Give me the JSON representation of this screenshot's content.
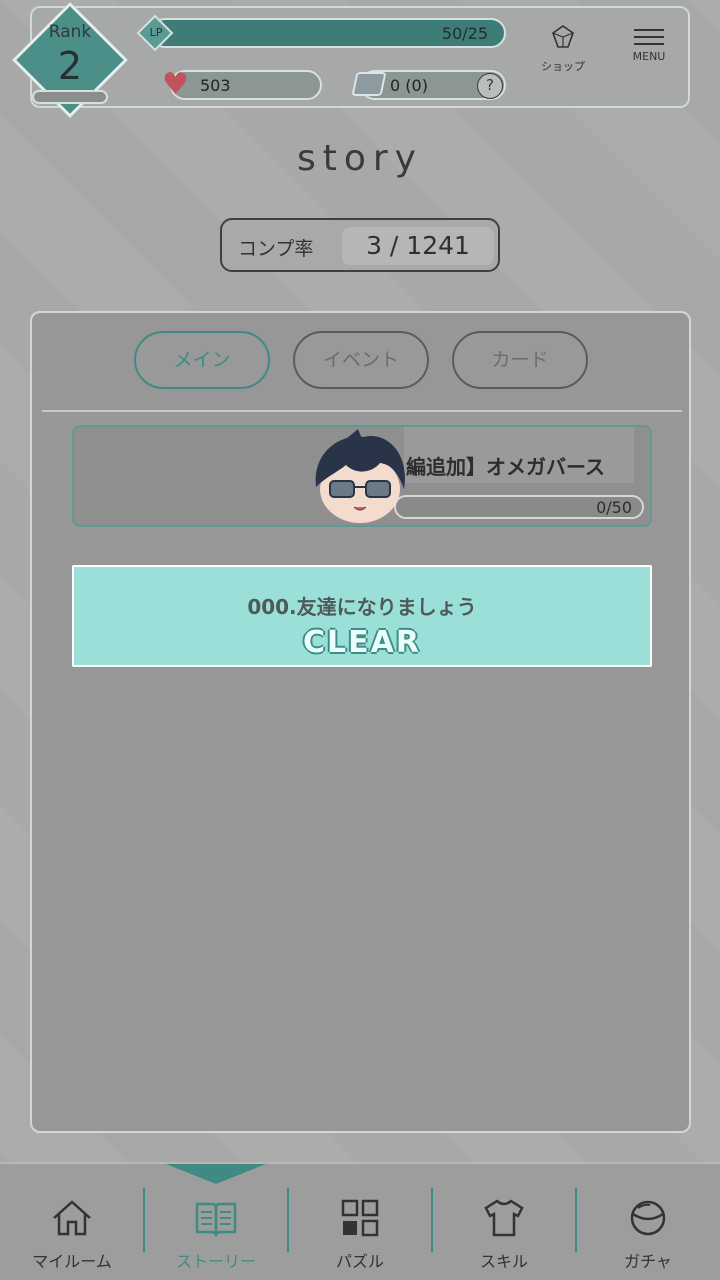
{
  "header": {
    "rank_label": "Rank",
    "rank_value": "2",
    "lp_tag": "LP",
    "lp_value": "50/25",
    "hearts": "503",
    "gems": "0 (0)",
    "help": "?",
    "shop_label": "ショップ",
    "menu_label": "MENU"
  },
  "page": {
    "title": "story",
    "completion_label": "コンプ率",
    "completion_value": "3 / 1241"
  },
  "tabs": [
    {
      "label": "メイン",
      "active": true
    },
    {
      "label": "イベント",
      "active": false
    },
    {
      "label": "カード",
      "active": false
    }
  ],
  "chapter": {
    "title": "編追加】オメガバース",
    "progress": "0/50"
  },
  "episode": {
    "title": "000.友達になりましょう",
    "status": "CLEAR"
  },
  "nav": [
    {
      "label": "マイルーム",
      "icon": "home-icon"
    },
    {
      "label": "ストーリー",
      "icon": "book-icon",
      "active": true
    },
    {
      "label": "パズル",
      "icon": "puzzle-grid-icon"
    },
    {
      "label": "スキル",
      "icon": "shirt-icon"
    },
    {
      "label": "ガチャ",
      "icon": "gacha-ball-icon"
    }
  ],
  "colors": {
    "accent": "#3f8b84",
    "clear_bg": "#9be0d8"
  }
}
